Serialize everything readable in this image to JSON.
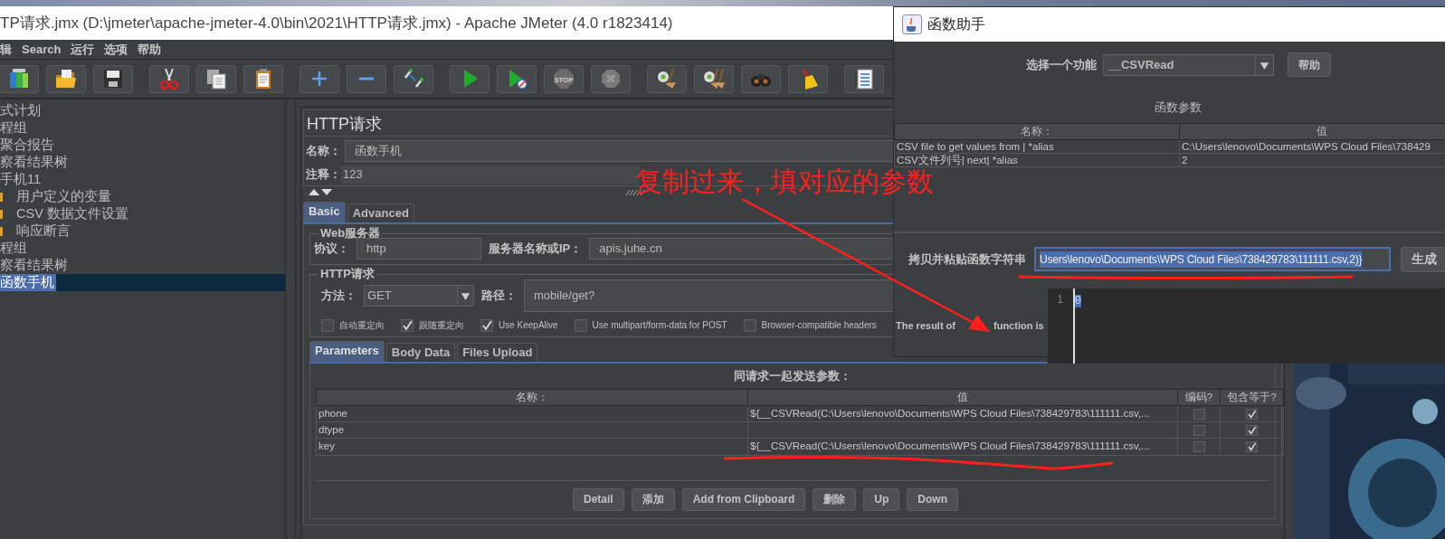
{
  "main_window": {
    "title": "TP请求.jmx (D:\\jmeter\\apache-jmeter-4.0\\bin\\2021\\HTTP请求.jmx) - Apache JMeter (4.0 r1823414)",
    "menu": [
      {
        "label": "辑"
      },
      {
        "label": "Search"
      },
      {
        "label": "运行"
      },
      {
        "label": "选项"
      },
      {
        "label": "帮助"
      }
    ],
    "toolbar": {
      "stop_label": "STOP"
    },
    "tree": [
      {
        "label": "式计划",
        "selected": false
      },
      {
        "label": "程组",
        "selected": false
      },
      {
        "label": "聚合报告",
        "selected": false
      },
      {
        "label": "察看结果树",
        "selected": false
      },
      {
        "label": "手机11",
        "selected": false,
        "children": [
          {
            "label": "用户定义的变量",
            "selected": false
          },
          {
            "label": "CSV 数据文件设置",
            "selected": false
          },
          {
            "label": "响应断言",
            "selected": false
          }
        ]
      },
      {
        "label": "程组",
        "selected": false
      },
      {
        "label": "察看结果树",
        "selected": false
      },
      {
        "label": "函数手机",
        "selected": true
      }
    ]
  },
  "http_request": {
    "title": "HTTP请求",
    "name_label": "名称：",
    "name": "函数手机",
    "comment_label": "注释：",
    "comment": "123",
    "tabs": [
      {
        "label": "Basic",
        "selected": true
      },
      {
        "label": "Advanced",
        "selected": false
      }
    ],
    "web_server": {
      "legend": "Web服务器",
      "protocol_label": "协议：",
      "protocol": "http",
      "server_label": "服务器名称或IP：",
      "server": "apis.juhe.cn"
    },
    "request": {
      "legend": "HTTP请求",
      "method_label": "方法：",
      "method": "GET",
      "path_label": "路径：",
      "path": "mobile/get?"
    },
    "options": [
      {
        "label": "自动重定向",
        "checked": false
      },
      {
        "label": "跟随重定向",
        "checked": true
      },
      {
        "label": "Use KeepAlive",
        "checked": true
      },
      {
        "label": "Use multipart/form-data for POST",
        "checked": false
      },
      {
        "label": "Browser-compatible headers",
        "checked": false
      }
    ],
    "param_tabs": [
      {
        "label": "Parameters",
        "selected": true
      },
      {
        "label": "Body Data",
        "selected": false
      },
      {
        "label": "Files Upload",
        "selected": false
      }
    ],
    "params_caption": "同请求一起发送参数：",
    "columns": [
      "名称：",
      "值",
      "编码?",
      "包含等于?"
    ],
    "rows": [
      {
        "name": "phone",
        "value": "${__CSVRead(C:\\Users\\lenovo\\Documents\\WPS Cloud Files\\738429783\\111111.csv,...",
        "encode": false,
        "include_equals": true
      },
      {
        "name": "dtype",
        "value": "",
        "encode": false,
        "include_equals": true
      },
      {
        "name": "key",
        "value": "${__CSVRead(C:\\Users\\lenovo\\Documents\\WPS Cloud Files\\738429783\\111111.csv,...",
        "encode": false,
        "include_equals": true
      }
    ],
    "buttons": [
      "Detail",
      "添加",
      "Add from Clipboard",
      "删除",
      "Up",
      "Down"
    ]
  },
  "function_helper": {
    "title": "函数助手",
    "select_label": "选择一个功能",
    "function": "__CSVRead",
    "help_button": "帮助",
    "params_title": "函数参数",
    "columns": [
      "名称：",
      "值"
    ],
    "rows": [
      {
        "name": "CSV file to get values from | *alias",
        "value": "C:\\Users\\lenovo\\Documents\\WPS Cloud Files\\738429"
      },
      {
        "name": "CSV文件列号| next| *alias",
        "value": "2"
      }
    ],
    "copy_label": "拷贝并粘贴函数字符串",
    "copy_value": "Users\\lenovo\\Documents\\WPS Cloud Files\\738429783\\111111.csv,2)}",
    "generate_button": "生成",
    "result_label": [
      "The result of",
      "function is"
    ],
    "result_line": "1",
    "result": "0"
  },
  "annotations": [
    {
      "text": "复制过来，填对应的参数"
    }
  ]
}
